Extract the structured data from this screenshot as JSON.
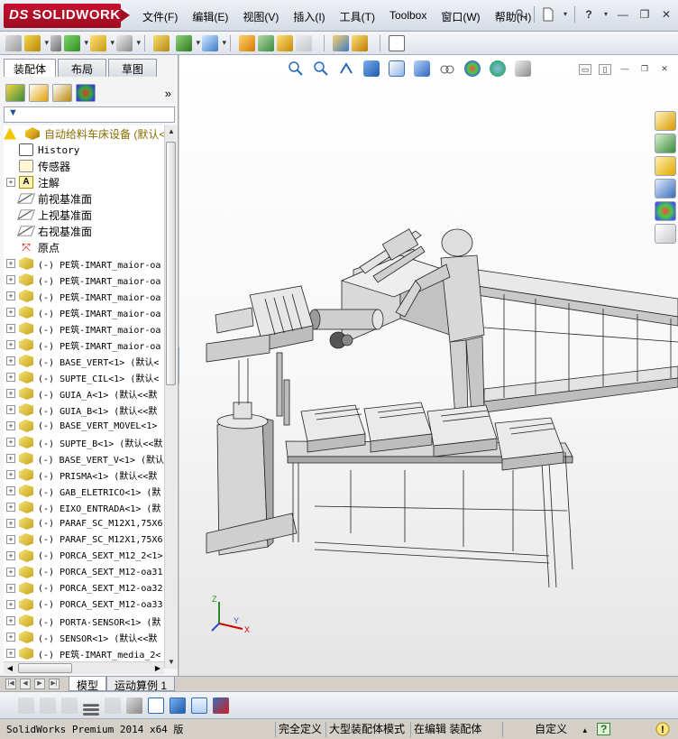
{
  "app": {
    "logo_prefix": "DS",
    "logo_name": "SOLIDWORKS"
  },
  "menu": [
    "文件(F)",
    "编辑(E)",
    "视图(V)",
    "插入(I)",
    "工具(T)",
    "Toolbox",
    "窗口(W)",
    "帮助(H)"
  ],
  "title_controls": {
    "pin": "pin-icon",
    "new": "new-document-icon",
    "help": "?",
    "minimize": "—",
    "restore": "❐",
    "close": "✕"
  },
  "toolbar_icons": [
    "assembly-insert-icon",
    "smart-mate-icon",
    "linear-pattern-icon",
    "smart-fasteners-icon",
    "move-component-icon",
    "hide-show-icon",
    "assembly-features-icon",
    "reference-geometry-icon",
    "new-motion-study-icon",
    "bill-of-materials-icon",
    "exploded-view-icon",
    "explode-line-icon",
    "interference-icon",
    "clearance-icon"
  ],
  "left_panel": {
    "tabs": [
      "装配体",
      "布局",
      "草图"
    ],
    "active_tab": "装配体",
    "manager_icons": [
      "featuremanager-icon",
      "propertymanager-icon",
      "configurationmanager-icon",
      "displaymanager-icon"
    ],
    "more": "»",
    "filter": "▼",
    "tree": [
      {
        "kind": "root",
        "label": "自动给料车床设备  (默认<"
      },
      {
        "kind": "hist",
        "label": "History"
      },
      {
        "kind": "sens",
        "label": "传感器"
      },
      {
        "kind": "note",
        "label": "注解",
        "expand": "+"
      },
      {
        "kind": "plane",
        "label": "前视基准面"
      },
      {
        "kind": "plane",
        "label": "上视基准面"
      },
      {
        "kind": "plane",
        "label": "右视基准面"
      },
      {
        "kind": "origin",
        "label": "原点"
      },
      {
        "kind": "part",
        "label": "(-) PE筑-IMART_maior-oa"
      },
      {
        "kind": "part",
        "label": "(-) PE筑-IMART_maior-oa"
      },
      {
        "kind": "part",
        "label": "(-) PE筑-IMART_maior-oa"
      },
      {
        "kind": "part",
        "label": "(-) PE筑-IMART_maior-oa"
      },
      {
        "kind": "part",
        "label": "(-) PE筑-IMART_maior-oa"
      },
      {
        "kind": "part",
        "label": "(-) PE筑-IMART_maior-oa"
      },
      {
        "kind": "part",
        "label": "(-) BASE_VERT<1> (默认<"
      },
      {
        "kind": "part",
        "label": "(-) SUPTE_CIL<1> (默认<"
      },
      {
        "kind": "part",
        "label": "(-) GUIA_A<1> (默认<<默"
      },
      {
        "kind": "part",
        "label": "(-) GUIA_B<1> (默认<<默"
      },
      {
        "kind": "part",
        "label": "(-) BASE_VERT_MOVEL<1>"
      },
      {
        "kind": "part",
        "label": "(-) SUPTE_B<1> (默认<<默"
      },
      {
        "kind": "part",
        "label": "(-) BASE_VERT_V<1> (默认"
      },
      {
        "kind": "part",
        "label": "(-) PRISMA<1> (默认<<默"
      },
      {
        "kind": "part",
        "label": "(-) GAB_ELETRICO<1> (默"
      },
      {
        "kind": "part",
        "label": "(-) EIXO_ENTRADA<1> (默"
      },
      {
        "kind": "part",
        "label": "(-) PARAF_SC_M12X1,75X6"
      },
      {
        "kind": "part",
        "label": "(-) PARAF_SC_M12X1,75X6"
      },
      {
        "kind": "part",
        "label": "(-) PORCA_SEXT_M12_2<1>"
      },
      {
        "kind": "part",
        "label": "(-) PORCA_SEXT_M12-oa31"
      },
      {
        "kind": "part",
        "label": "(-) PORCA_SEXT_M12-oa32"
      },
      {
        "kind": "part",
        "label": "(-) PORCA_SEXT_M12-oa33"
      },
      {
        "kind": "part",
        "label": "(-) PORTA-SENSOR<1> (默"
      },
      {
        "kind": "part",
        "label": "(-) SENSOR<1> (默认<<默"
      },
      {
        "kind": "part",
        "label": "(-) PE筑-IMART_media_2<"
      }
    ]
  },
  "view_toolbar": [
    "zoom-to-fit-icon",
    "zoom-to-area-icon",
    "previous-view-icon",
    "section-view-icon",
    "view-orientation-icon",
    "display-style-icon",
    "hide-show-items-icon",
    "edit-appearance-icon",
    "apply-scene-icon",
    "view-settings-icon"
  ],
  "window_controls": [
    "tile-horizontal-icon",
    "tile-vertical-icon",
    "minimize-icon",
    "restore-icon",
    "close-icon"
  ],
  "task_pane": [
    "solidworks-resources-icon",
    "design-library-icon",
    "file-explorer-icon",
    "view-palette-icon",
    "appearances-icon",
    "custom-properties-icon"
  ],
  "triad": {
    "x": "X",
    "y": "Y",
    "z": "Z"
  },
  "bottom_tabs": [
    "模型",
    "运动算例 1"
  ],
  "hud_icons": [
    "hud-1-icon",
    "hud-2-icon",
    "hud-3-icon",
    "hud-4-icon",
    "hud-5-icon",
    "hud-6-icon",
    "hud-7-icon",
    "hud-8-icon",
    "hud-9-icon",
    "hud-10-icon"
  ],
  "status": {
    "product": "SolidWorks Premium 2014 x64 版",
    "definition": "完全定义",
    "mode": "大型装配体模式",
    "editing": "在编辑 装配体",
    "units": "自定义",
    "units_arrow": "▴",
    "help": "?",
    "rebuild": "!"
  },
  "colors": {
    "brand": "#c8102e",
    "root_label": "#8a6d00",
    "viewport_bg": "#ffffff"
  }
}
